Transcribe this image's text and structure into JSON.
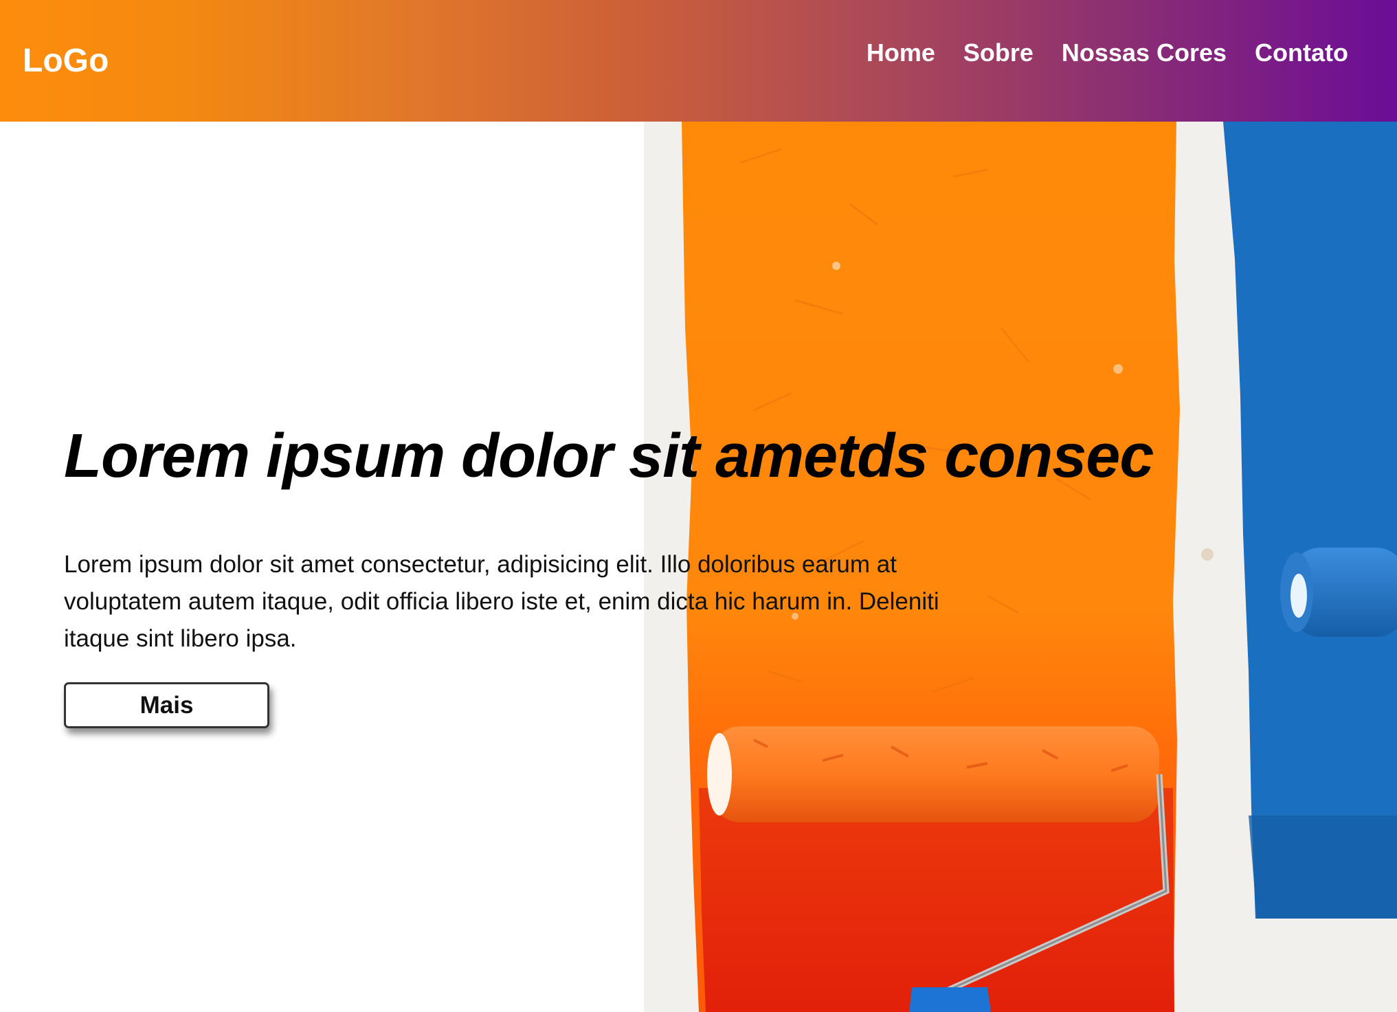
{
  "header": {
    "logo": "LoGo",
    "nav": [
      "Home",
      "Sobre",
      "Nossas Cores",
      "Contato"
    ]
  },
  "hero": {
    "title": "Lorem ipsum dolor sit ametds consec",
    "text": "Lorem ipsum dolor sit amet consectetur, adipisicing elit. Illo doloribus earum at voluptatem autem itaque, odit officia libero iste et, enim dicta hic harum in. Deleniti itaque sint libero ipsa.",
    "button_label": "Mais"
  },
  "colors": {
    "header_gradient_start": "#fd8c0c",
    "header_gradient_end": "#6b0d97",
    "paint_orange": "#ff8c0a",
    "paint_red": "#e8240a",
    "paint_blue": "#1a6fc0"
  }
}
